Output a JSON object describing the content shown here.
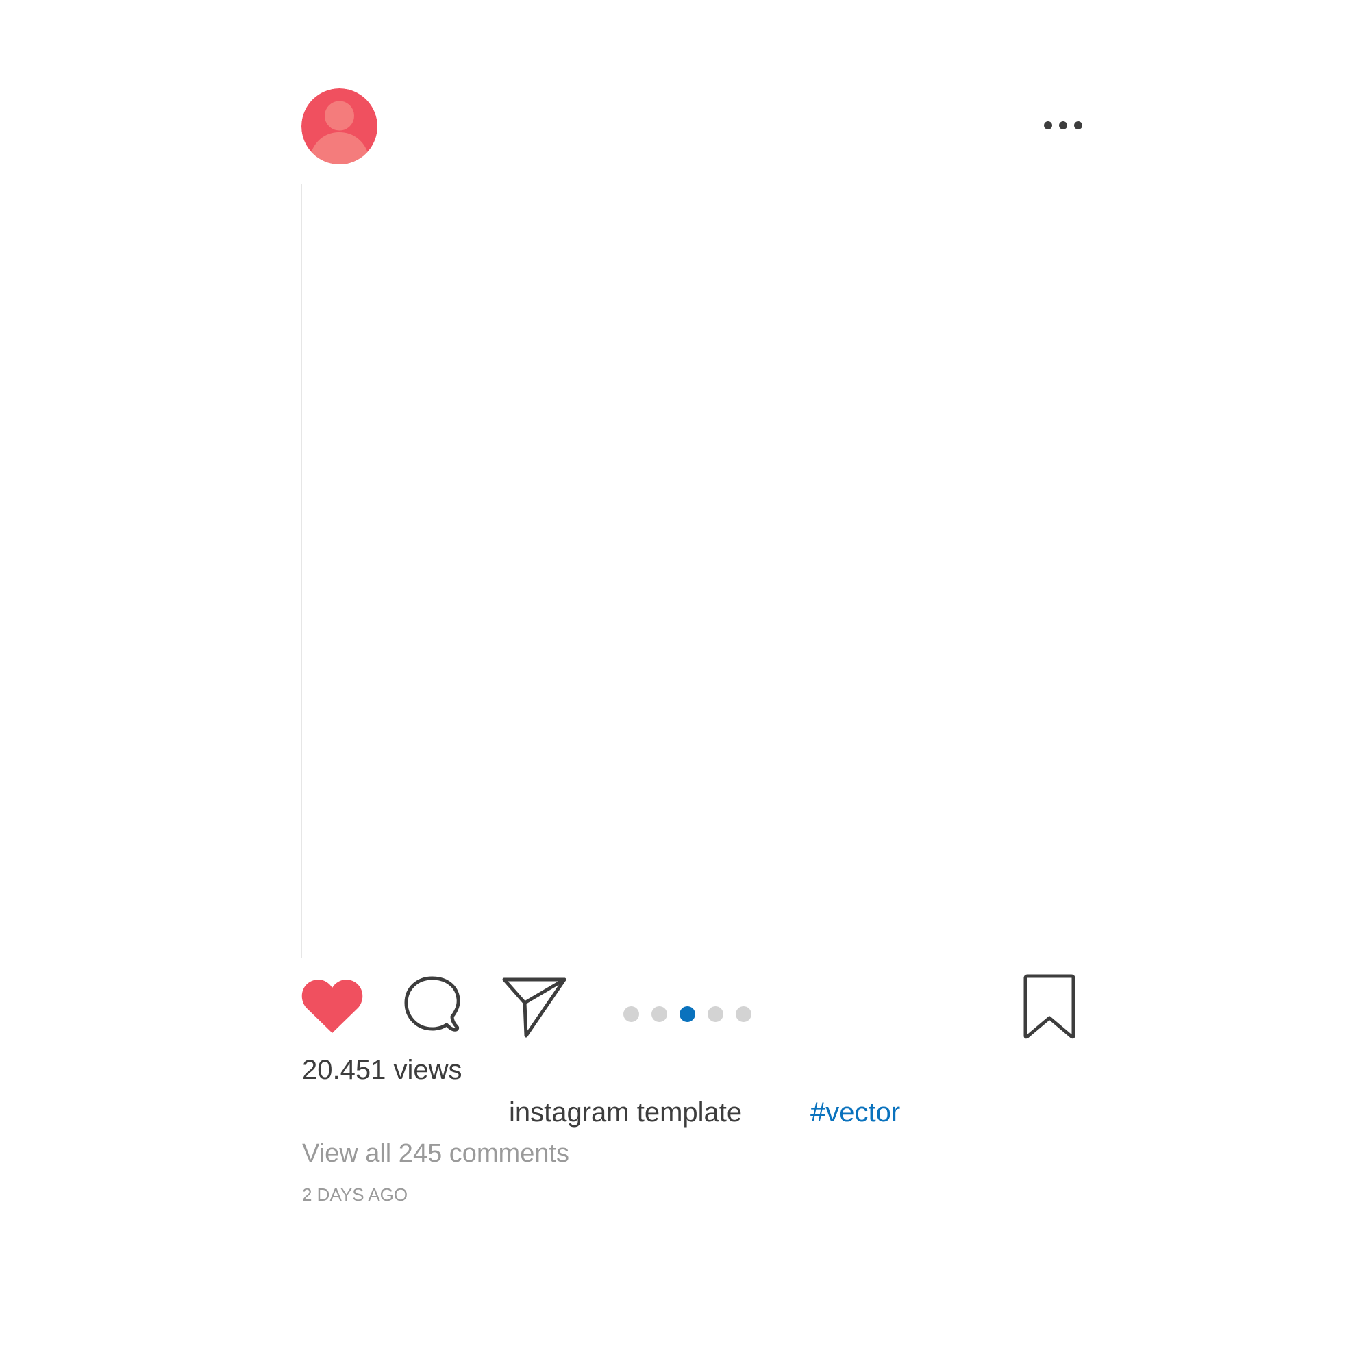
{
  "post": {
    "views": "20.451 views",
    "caption": "instagram template",
    "hashtag": "#vector",
    "comments_link": "View all 245 comments",
    "timestamp": "2 DAYS AGO"
  },
  "icons": {
    "avatar": "user-avatar-icon",
    "more": "more-options-icon",
    "like": "heart-icon",
    "comment": "speech-bubble-icon",
    "share": "paper-plane-icon",
    "save": "bookmark-icon"
  },
  "carousel": {
    "total": 5,
    "active_index": 2
  },
  "colors": {
    "like": "#f0505f",
    "avatar_bg": "#f0505f",
    "avatar_figure": "#f47c7c",
    "active_dot": "#0a72bd",
    "inactive_dot": "#d3d3d3",
    "hashtag": "#0a72bd",
    "text": "#3d3d3d",
    "muted_text": "#9a9a9a"
  }
}
